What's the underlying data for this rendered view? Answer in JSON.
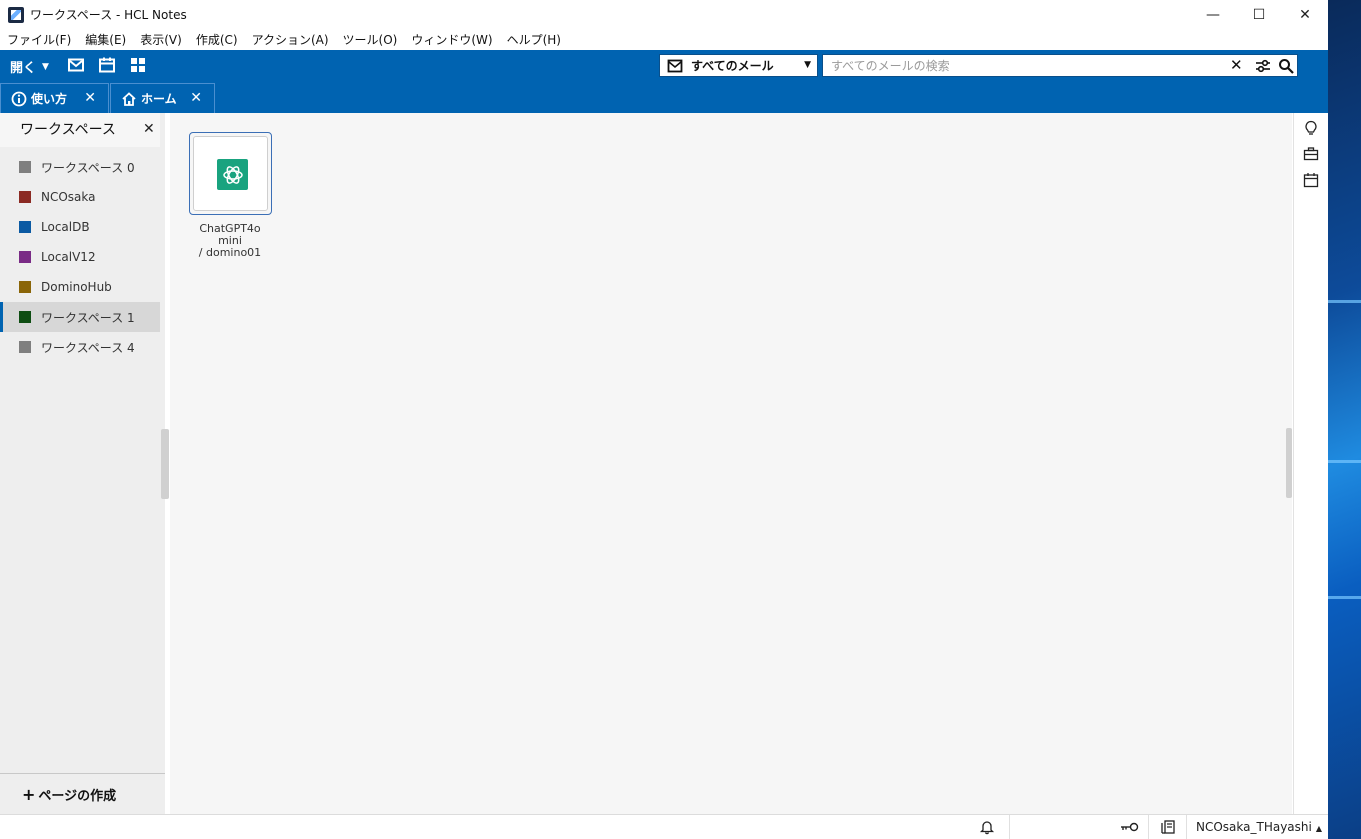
{
  "window": {
    "title": "ワークスペース - HCL Notes",
    "controls": {
      "minimize": "—",
      "maximize": "☐",
      "close": "✕"
    }
  },
  "menu": [
    "ファイル(F)",
    "編集(E)",
    "表示(V)",
    "作成(C)",
    "アクション(A)",
    "ツール(O)",
    "ウィンドウ(W)",
    "ヘルプ(H)"
  ],
  "toolbar": {
    "open_label": "開く",
    "icons": [
      "mail-icon",
      "calendar-icon",
      "apps-grid-icon"
    ],
    "mail_scope": "すべてのメール",
    "search_placeholder": "すべてのメールの検索"
  },
  "tabs": [
    {
      "label": "使い方",
      "icon": "info-icon"
    },
    {
      "label": "ホーム",
      "icon": "home-icon"
    }
  ],
  "sidebar": {
    "title": "ワークスペース",
    "items": [
      {
        "label": "ワークスペース 0",
        "color": "#7f7f7f"
      },
      {
        "label": "NCOsaka",
        "color": "#8b2a23"
      },
      {
        "label": "LocalDB",
        "color": "#0b5aa3"
      },
      {
        "label": "LocalV12",
        "color": "#7a2b86"
      },
      {
        "label": "DominoHub",
        "color": "#8a6508"
      },
      {
        "label": "ワークスペース 1",
        "color": "#0e4d12",
        "active": true
      },
      {
        "label": "ワークスペース 4",
        "color": "#7f7f7f"
      }
    ],
    "new_page_label": "ページの作成"
  },
  "main": {
    "tiles": [
      {
        "line1": "ChatGPT4o",
        "line2": "mini",
        "line3": "/ domino01",
        "icon": "openai-logo-icon",
        "color": "#19a37f"
      }
    ]
  },
  "right_rail": [
    "lightbulb-icon",
    "briefcase-icon",
    "calendar-icon"
  ],
  "status": {
    "user": "NCOsaka_THayashi",
    "icons": [
      "bell-icon",
      "key-icon",
      "server-icon"
    ]
  },
  "colors": {
    "accent": "#0063b1",
    "accent_dark": "#0a4f8a"
  }
}
